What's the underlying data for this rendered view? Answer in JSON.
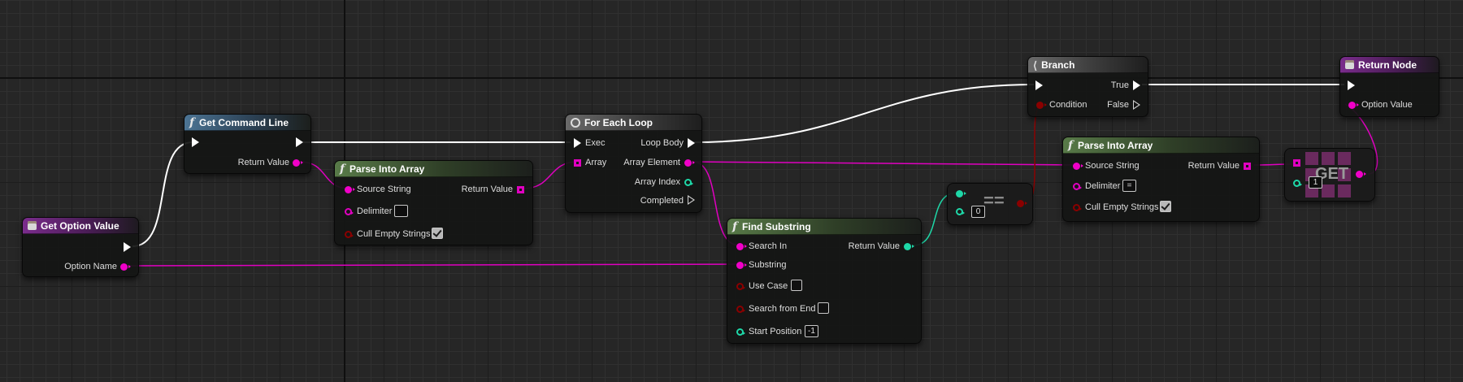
{
  "nodes": {
    "get_command_line": {
      "title": "Get Command Line",
      "return_value": "Return Value"
    },
    "get_option_value": {
      "title": "Get Option Value",
      "option_name": "Option Name"
    },
    "parse_into_array_1": {
      "title": "Parse Into Array",
      "source_string": "Source String",
      "delimiter": "Delimiter",
      "delimiter_value": "",
      "cull_empty_strings": "Cull Empty Strings",
      "return_value": "Return Value"
    },
    "for_each_loop": {
      "title": "For Each Loop",
      "exec": "Exec",
      "array": "Array",
      "loop_body": "Loop Body",
      "array_element": "Array Element",
      "array_index": "Array Index",
      "completed": "Completed"
    },
    "find_substring": {
      "title": "Find Substring",
      "search_in": "Search In",
      "substring": "Substring",
      "use_case": "Use Case",
      "search_from_end": "Search from End",
      "start_position": "Start Position",
      "start_position_value": "-1",
      "return_value": "Return Value"
    },
    "equals": {
      "symbol": "==",
      "value": "0"
    },
    "branch": {
      "title": "Branch",
      "condition": "Condition",
      "true": "True",
      "false": "False"
    },
    "parse_into_array_2": {
      "title": "Parse Into Array",
      "source_string": "Source String",
      "delimiter": "Delimiter",
      "delimiter_value": "=",
      "cull_empty_strings": "Cull Empty Strings",
      "return_value": "Return Value"
    },
    "get": {
      "label": "GET",
      "index_value": "1"
    },
    "return_node": {
      "title": "Return Node",
      "option_value": "Option Value"
    }
  },
  "colors": {
    "exec": "#ffffff",
    "string": "#e000c0",
    "integer": "#1ed8a8",
    "boolean": "#8a0000",
    "function_header": "#587a48",
    "pure_header": "#4c7494",
    "entry_header": "#7a2c8c"
  },
  "icons": {
    "function": "function-f-icon",
    "loop": "loop-icon",
    "branch": "branch-icon",
    "entry": "entry-box-icon"
  }
}
